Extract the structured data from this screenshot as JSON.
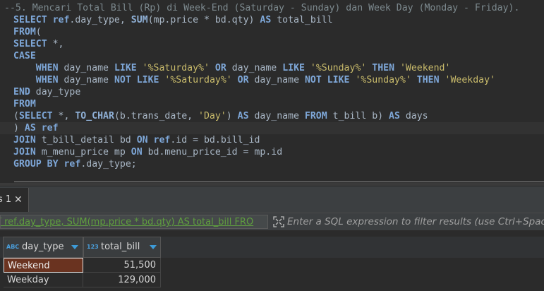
{
  "editor": {
    "lines": [
      [
        [
          "com",
          "--5. Mencari Total Bill (Rp) di Week-End (Saturday - Sunday) dan Week Day (Monday - Friday).  "
        ]
      ],
      [
        [
          "kw",
          "SELECT "
        ],
        [
          "ref",
          "ref"
        ],
        [
          "op",
          "."
        ],
        [
          "ident",
          "day_type, "
        ],
        [
          "fn",
          "SUM"
        ],
        [
          "op",
          "(mp.price * bd.qty) "
        ],
        [
          "kw",
          "AS"
        ],
        [
          "ident",
          " total_bill"
        ]
      ],
      [
        [
          "kw",
          "FROM"
        ],
        [
          "op",
          "("
        ]
      ],
      [
        [
          "kw",
          "SELECT"
        ],
        [
          "op",
          " *,"
        ]
      ],
      [
        [
          "kw",
          "CASE"
        ]
      ],
      [
        [
          "op",
          "    "
        ],
        [
          "kw",
          "WHEN"
        ],
        [
          "ident",
          " day_name "
        ],
        [
          "kw",
          "LIKE"
        ],
        [
          "op",
          " "
        ],
        [
          "str",
          "'%Saturday%'"
        ],
        [
          "op",
          " "
        ],
        [
          "kw",
          "OR"
        ],
        [
          "ident",
          " day_name "
        ],
        [
          "kw",
          "LIKE"
        ],
        [
          "op",
          " "
        ],
        [
          "str",
          "'%Sunday%'"
        ],
        [
          "op",
          " "
        ],
        [
          "kw",
          "THEN"
        ],
        [
          "op",
          " "
        ],
        [
          "str",
          "'Weekend'"
        ]
      ],
      [
        [
          "op",
          "    "
        ],
        [
          "kw",
          "WHEN"
        ],
        [
          "ident",
          " day_name "
        ],
        [
          "kw",
          "NOT LIKE"
        ],
        [
          "op",
          " "
        ],
        [
          "str",
          "'%Saturday%'"
        ],
        [
          "op",
          " "
        ],
        [
          "kw",
          "OR"
        ],
        [
          "ident",
          " day_name "
        ],
        [
          "kw",
          "NOT LIKE"
        ],
        [
          "op",
          " "
        ],
        [
          "str",
          "'%Sunday%'"
        ],
        [
          "op",
          " "
        ],
        [
          "kw",
          "THEN"
        ],
        [
          "op",
          " "
        ],
        [
          "str",
          "'Weekday'"
        ]
      ],
      [
        [
          "kw",
          "END"
        ],
        [
          "ident",
          " day_type"
        ]
      ],
      [
        [
          "kw",
          "FROM"
        ]
      ],
      [
        [
          "op",
          "("
        ],
        [
          "kw",
          "SELECT"
        ],
        [
          "op",
          " *, "
        ],
        [
          "fn",
          "TO_CHAR"
        ],
        [
          "op",
          "(b.trans_date, "
        ],
        [
          "str",
          "'Day'"
        ],
        [
          "op",
          ") "
        ],
        [
          "kw",
          "AS"
        ],
        [
          "ident",
          " day_name "
        ],
        [
          "kw",
          "FROM"
        ],
        [
          "ident",
          " t_bill b) "
        ],
        [
          "kw",
          "AS"
        ],
        [
          "ident",
          " days"
        ]
      ],
      [
        [
          "op",
          ") "
        ],
        [
          "kw",
          "AS"
        ],
        [
          "op",
          " "
        ],
        [
          "ref",
          "ref"
        ]
      ],
      [
        [
          "kw",
          "JOIN"
        ],
        [
          "ident",
          " t_bill_detail bd "
        ],
        [
          "kw",
          "ON"
        ],
        [
          "op",
          " "
        ],
        [
          "ref",
          "ref"
        ],
        [
          "op",
          ".id = bd.bill_id"
        ]
      ],
      [
        [
          "kw",
          "JOIN"
        ],
        [
          "ident",
          " m_menu_price mp "
        ],
        [
          "kw",
          "ON"
        ],
        [
          "ident",
          " bd.menu_price_id = mp.id"
        ]
      ],
      [
        [
          "kw",
          "GROUP BY"
        ],
        [
          "op",
          " "
        ],
        [
          "ref",
          "ref"
        ],
        [
          "op",
          ".day_type;"
        ]
      ]
    ]
  },
  "results_tab": {
    "label": "s 1",
    "close_glyph": "✕"
  },
  "filter": {
    "query_text": "T ref.day_type, SUM(mp.price * bd.qty) AS total_bill FRO",
    "placeholder": "Enter a SQL expression to filter results (use Ctrl+Space)",
    "icon": "filter-expand-icon"
  },
  "grid": {
    "columns": [
      {
        "type_badge": "ABC",
        "label": "day_type"
      },
      {
        "type_badge": "123",
        "label": "total_bill"
      }
    ],
    "rows": [
      {
        "day_type": "Weekend",
        "total_bill": "51,500"
      },
      {
        "day_type": "Weekday",
        "total_bill": "129,000"
      }
    ]
  },
  "colors": {
    "editor_bg": "#2b2b2b",
    "keyword": "#7ea7d8",
    "string": "#c9bb6b",
    "comment": "#7d8a8f",
    "selected_cell_bg": "#6a3320",
    "sort_arrow": "#3d9bd8",
    "filter_query_text": "#5f9e3f"
  }
}
